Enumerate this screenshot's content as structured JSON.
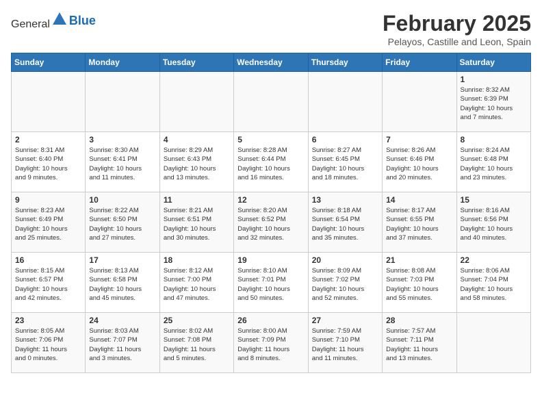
{
  "header": {
    "logo_line1": "General",
    "logo_line2": "Blue",
    "month_title": "February 2025",
    "subtitle": "Pelayos, Castille and Leon, Spain"
  },
  "weekdays": [
    "Sunday",
    "Monday",
    "Tuesday",
    "Wednesday",
    "Thursday",
    "Friday",
    "Saturday"
  ],
  "weeks": [
    [
      {
        "day": "",
        "info": ""
      },
      {
        "day": "",
        "info": ""
      },
      {
        "day": "",
        "info": ""
      },
      {
        "day": "",
        "info": ""
      },
      {
        "day": "",
        "info": ""
      },
      {
        "day": "",
        "info": ""
      },
      {
        "day": "1",
        "info": "Sunrise: 8:32 AM\nSunset: 6:39 PM\nDaylight: 10 hours\nand 7 minutes."
      }
    ],
    [
      {
        "day": "2",
        "info": "Sunrise: 8:31 AM\nSunset: 6:40 PM\nDaylight: 10 hours\nand 9 minutes."
      },
      {
        "day": "3",
        "info": "Sunrise: 8:30 AM\nSunset: 6:41 PM\nDaylight: 10 hours\nand 11 minutes."
      },
      {
        "day": "4",
        "info": "Sunrise: 8:29 AM\nSunset: 6:43 PM\nDaylight: 10 hours\nand 13 minutes."
      },
      {
        "day": "5",
        "info": "Sunrise: 8:28 AM\nSunset: 6:44 PM\nDaylight: 10 hours\nand 16 minutes."
      },
      {
        "day": "6",
        "info": "Sunrise: 8:27 AM\nSunset: 6:45 PM\nDaylight: 10 hours\nand 18 minutes."
      },
      {
        "day": "7",
        "info": "Sunrise: 8:26 AM\nSunset: 6:46 PM\nDaylight: 10 hours\nand 20 minutes."
      },
      {
        "day": "8",
        "info": "Sunrise: 8:24 AM\nSunset: 6:48 PM\nDaylight: 10 hours\nand 23 minutes."
      }
    ],
    [
      {
        "day": "9",
        "info": "Sunrise: 8:23 AM\nSunset: 6:49 PM\nDaylight: 10 hours\nand 25 minutes."
      },
      {
        "day": "10",
        "info": "Sunrise: 8:22 AM\nSunset: 6:50 PM\nDaylight: 10 hours\nand 27 minutes."
      },
      {
        "day": "11",
        "info": "Sunrise: 8:21 AM\nSunset: 6:51 PM\nDaylight: 10 hours\nand 30 minutes."
      },
      {
        "day": "12",
        "info": "Sunrise: 8:20 AM\nSunset: 6:52 PM\nDaylight: 10 hours\nand 32 minutes."
      },
      {
        "day": "13",
        "info": "Sunrise: 8:18 AM\nSunset: 6:54 PM\nDaylight: 10 hours\nand 35 minutes."
      },
      {
        "day": "14",
        "info": "Sunrise: 8:17 AM\nSunset: 6:55 PM\nDaylight: 10 hours\nand 37 minutes."
      },
      {
        "day": "15",
        "info": "Sunrise: 8:16 AM\nSunset: 6:56 PM\nDaylight: 10 hours\nand 40 minutes."
      }
    ],
    [
      {
        "day": "16",
        "info": "Sunrise: 8:15 AM\nSunset: 6:57 PM\nDaylight: 10 hours\nand 42 minutes."
      },
      {
        "day": "17",
        "info": "Sunrise: 8:13 AM\nSunset: 6:58 PM\nDaylight: 10 hours\nand 45 minutes."
      },
      {
        "day": "18",
        "info": "Sunrise: 8:12 AM\nSunset: 7:00 PM\nDaylight: 10 hours\nand 47 minutes."
      },
      {
        "day": "19",
        "info": "Sunrise: 8:10 AM\nSunset: 7:01 PM\nDaylight: 10 hours\nand 50 minutes."
      },
      {
        "day": "20",
        "info": "Sunrise: 8:09 AM\nSunset: 7:02 PM\nDaylight: 10 hours\nand 52 minutes."
      },
      {
        "day": "21",
        "info": "Sunrise: 8:08 AM\nSunset: 7:03 PM\nDaylight: 10 hours\nand 55 minutes."
      },
      {
        "day": "22",
        "info": "Sunrise: 8:06 AM\nSunset: 7:04 PM\nDaylight: 10 hours\nand 58 minutes."
      }
    ],
    [
      {
        "day": "23",
        "info": "Sunrise: 8:05 AM\nSunset: 7:06 PM\nDaylight: 11 hours\nand 0 minutes."
      },
      {
        "day": "24",
        "info": "Sunrise: 8:03 AM\nSunset: 7:07 PM\nDaylight: 11 hours\nand 3 minutes."
      },
      {
        "day": "25",
        "info": "Sunrise: 8:02 AM\nSunset: 7:08 PM\nDaylight: 11 hours\nand 5 minutes."
      },
      {
        "day": "26",
        "info": "Sunrise: 8:00 AM\nSunset: 7:09 PM\nDaylight: 11 hours\nand 8 minutes."
      },
      {
        "day": "27",
        "info": "Sunrise: 7:59 AM\nSunset: 7:10 PM\nDaylight: 11 hours\nand 11 minutes."
      },
      {
        "day": "28",
        "info": "Sunrise: 7:57 AM\nSunset: 7:11 PM\nDaylight: 11 hours\nand 13 minutes."
      },
      {
        "day": "",
        "info": ""
      }
    ]
  ]
}
